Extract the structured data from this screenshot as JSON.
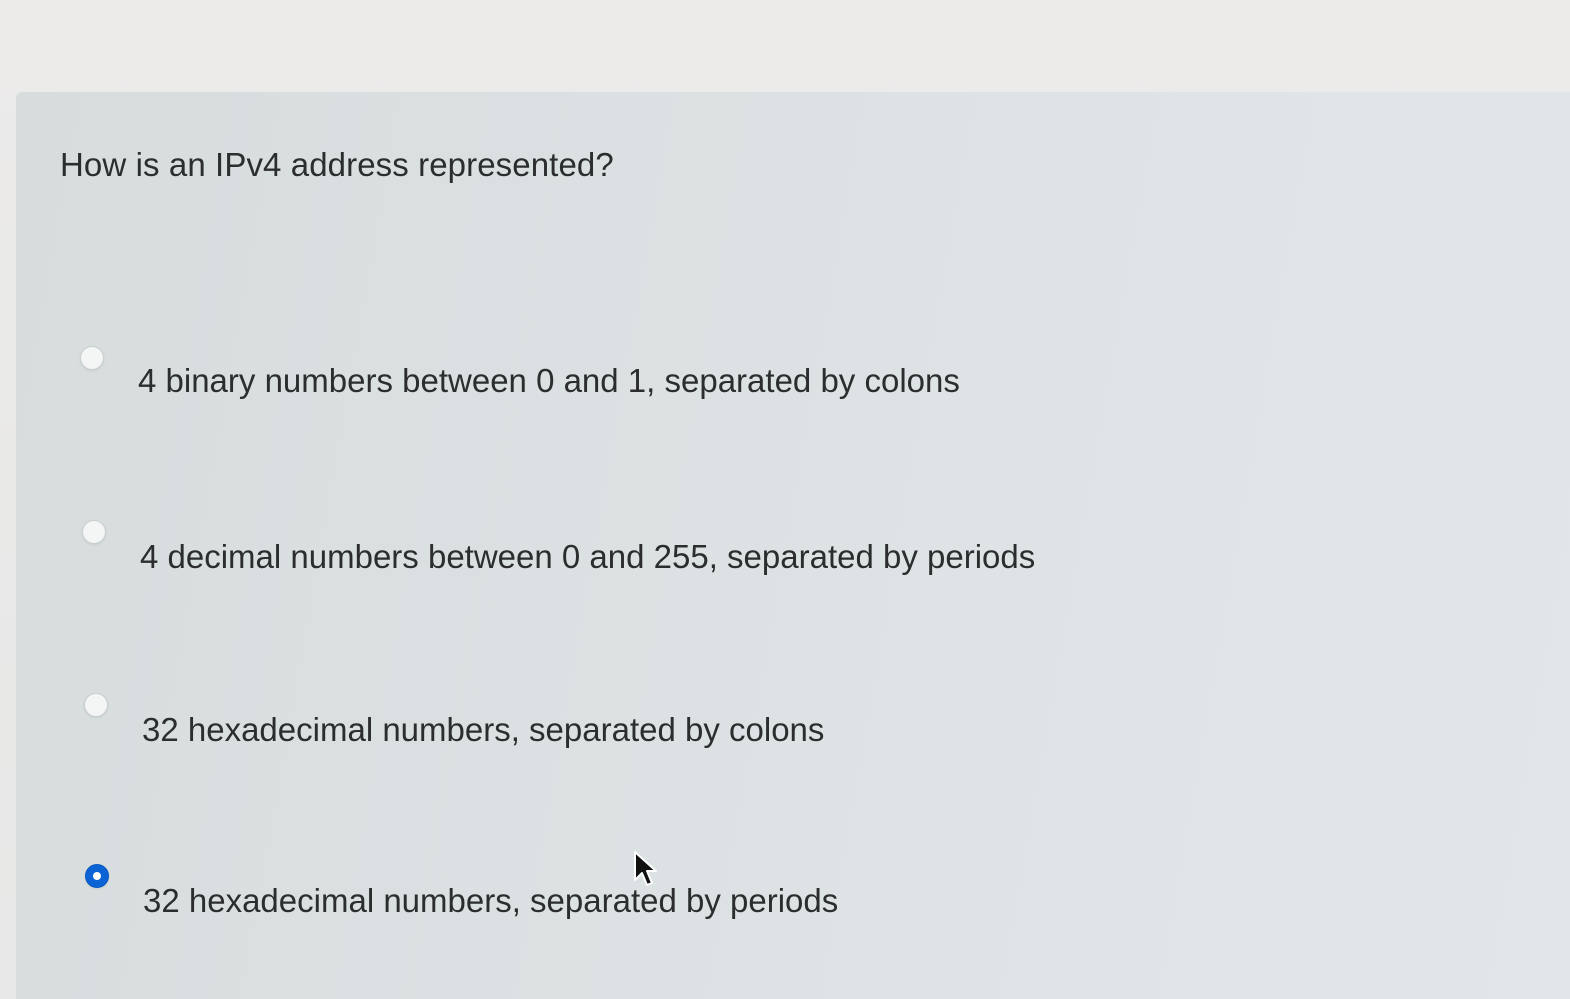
{
  "question": {
    "text": "How is an IPv4 address represented?"
  },
  "options": [
    {
      "label": "4 binary numbers between 0 and 1, separated by colons",
      "selected": false
    },
    {
      "label": "4 decimal numbers between 0 and 255, separated by periods",
      "selected": false
    },
    {
      "label": "32 hexadecimal numbers, separated by colons",
      "selected": false
    },
    {
      "label": "32 hexadecimal numbers, separated by periods",
      "selected": true
    }
  ],
  "colors": {
    "accent": "#0b63d6",
    "panel": "#dce2e3",
    "text": "#2b2d2e"
  },
  "icons": {
    "cursor": "mouse-pointer-icon"
  }
}
